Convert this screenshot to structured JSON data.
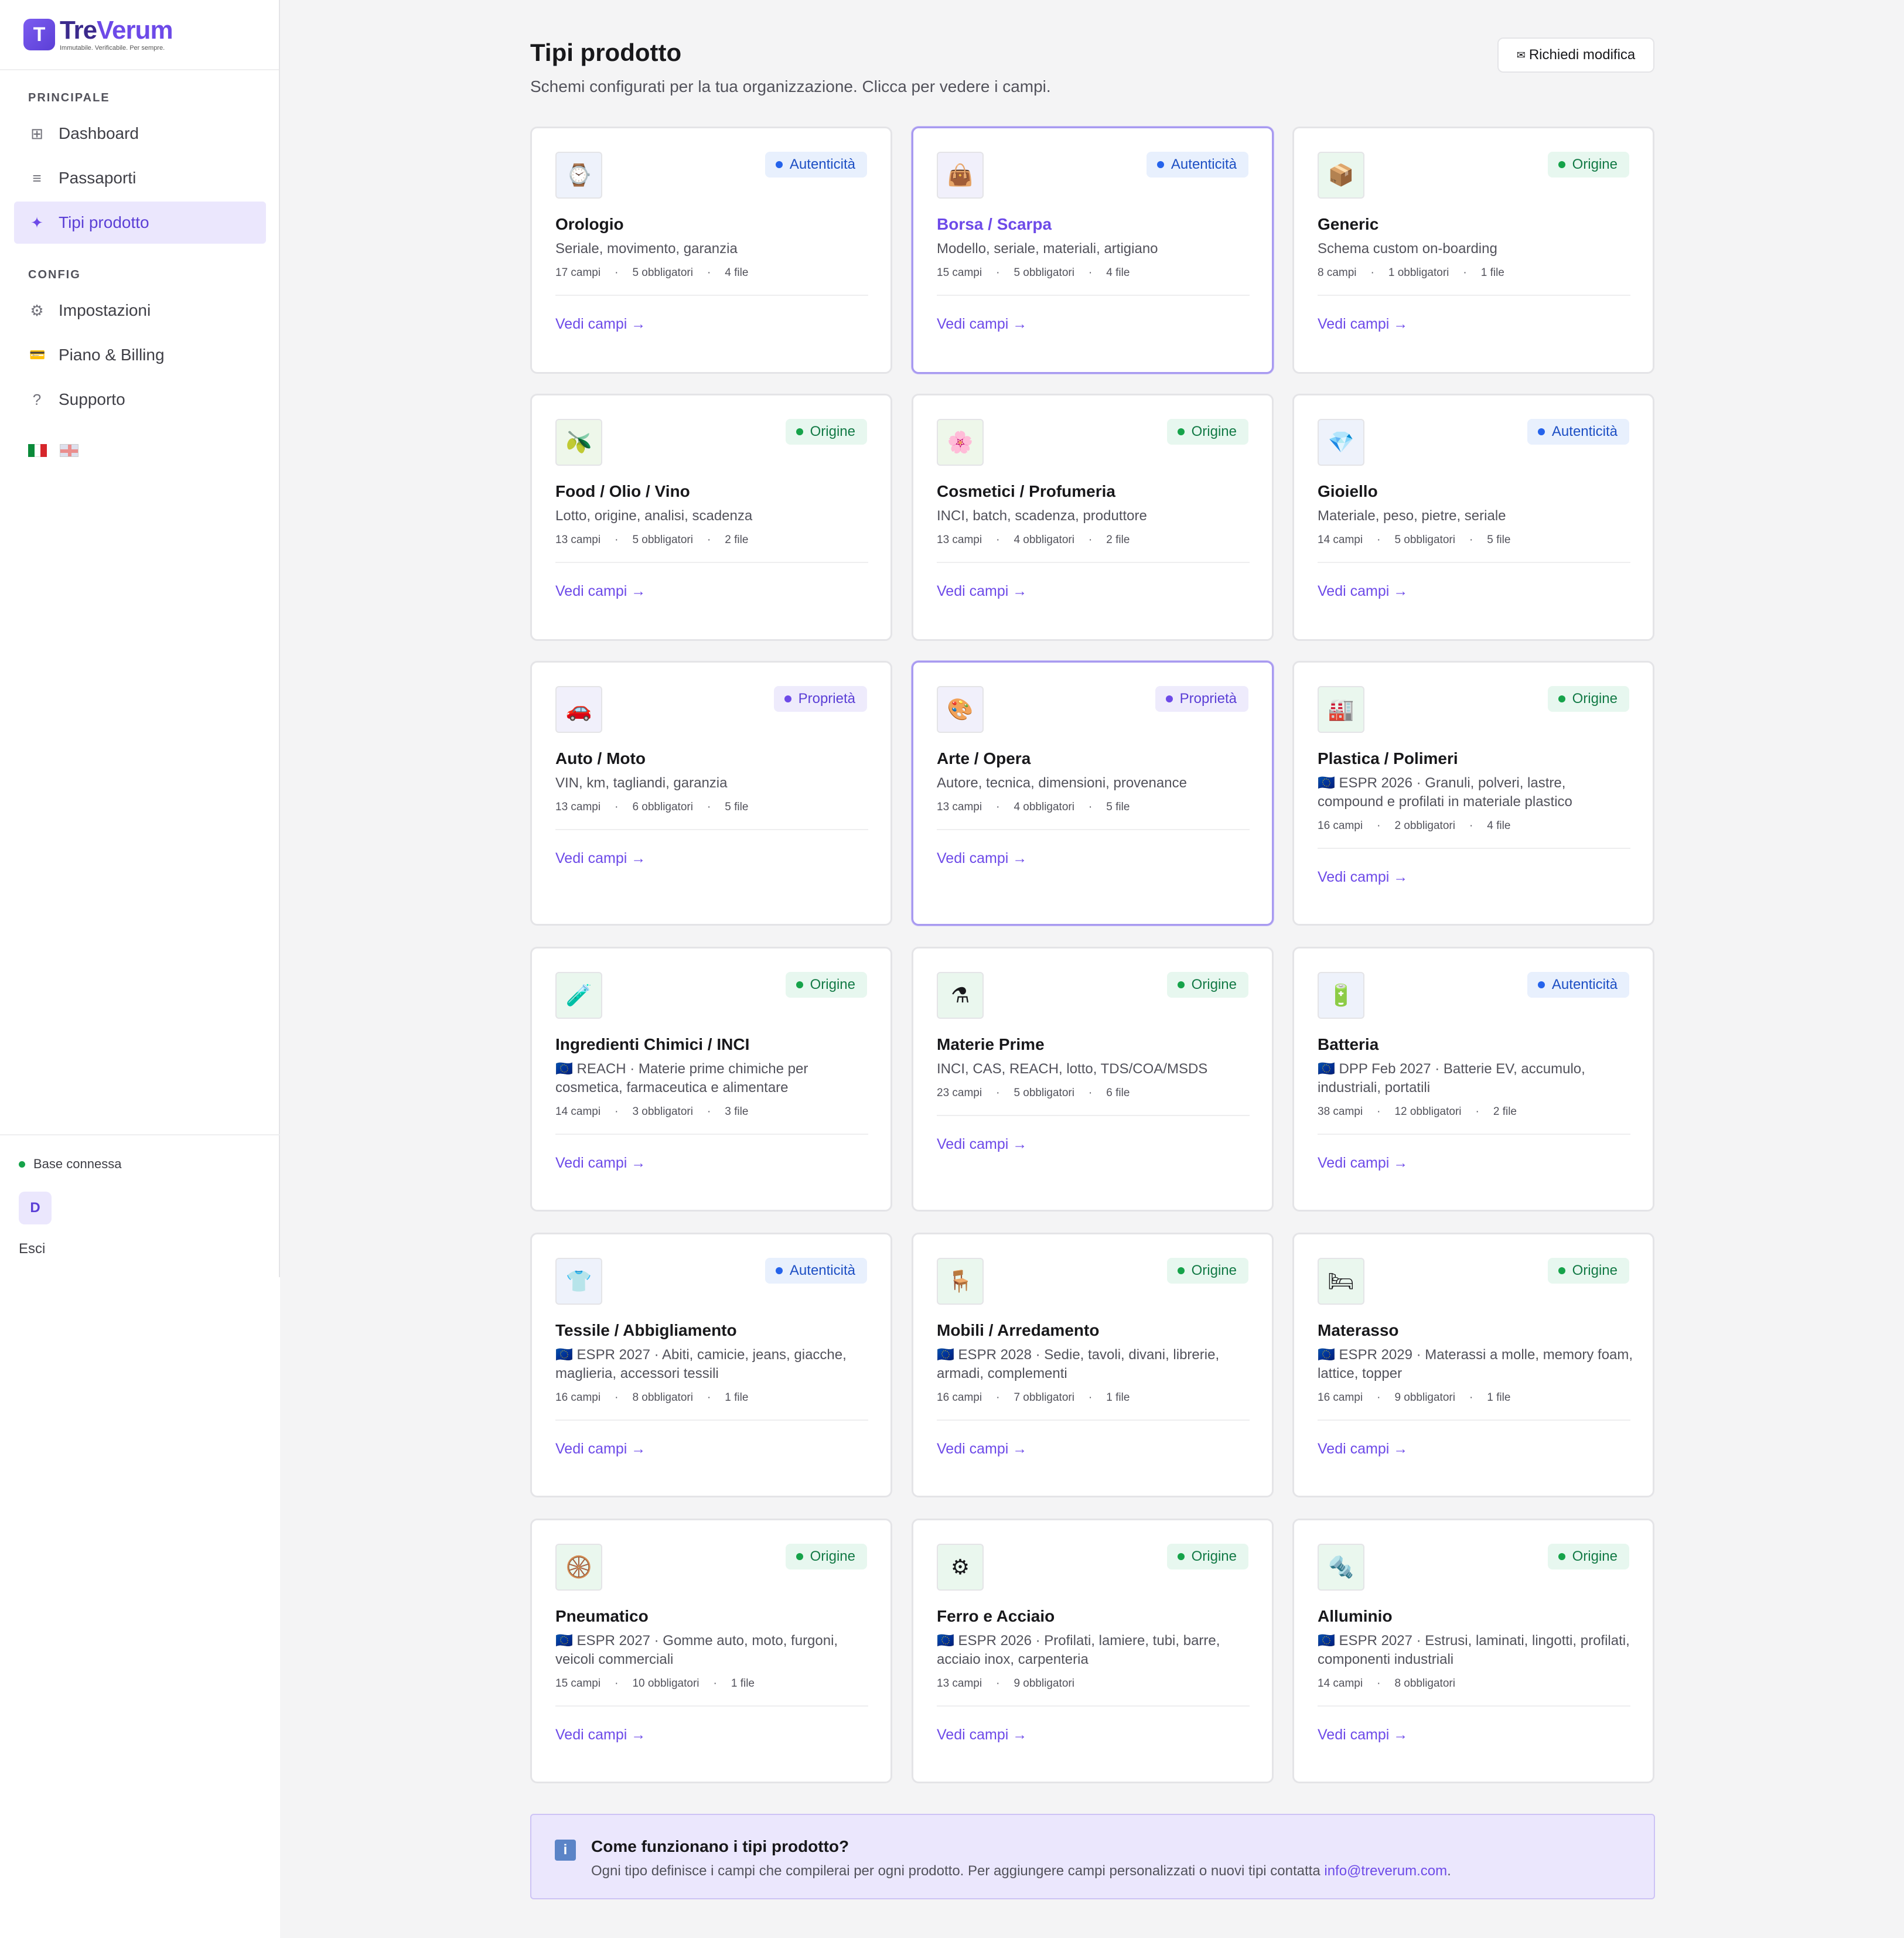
{
  "brand": {
    "name_a": "Tre",
    "name_b": "Verum",
    "tagline": "Immutabile. Verificabile. Per sempre.",
    "logo_letter": "T"
  },
  "sidebar": {
    "section_main": "PRINCIPALE",
    "section_config": "CONFIG",
    "items": [
      {
        "label": "Dashboard",
        "icon": "grid-icon",
        "glyph": "⊞"
      },
      {
        "label": "Passaporti",
        "icon": "list-icon",
        "glyph": "≡"
      },
      {
        "label": "Tipi prodotto",
        "icon": "sparkle-icon",
        "glyph": "✦"
      },
      {
        "label": "Impostazioni",
        "icon": "gear-icon",
        "glyph": "⚙"
      },
      {
        "label": "Piano & Billing",
        "icon": "credit-card-icon",
        "glyph": "💳"
      },
      {
        "label": "Supporto",
        "icon": "question-icon",
        "glyph": "?"
      }
    ],
    "status": "Base connessa",
    "avatar": "D",
    "logout": "Esci"
  },
  "header": {
    "title": "Tipi prodotto",
    "subtitle": "Schemi configurati per la tua organizzazione. Clicca per vedere i campi.",
    "request_button": "Richiedi modifica",
    "request_icon": "✉"
  },
  "cards": [
    {
      "title": "Orologio",
      "icon": "⌚",
      "badge": "Autenticità",
      "desc": "Seriale, movimento, garanzia",
      "fields": "17 campi",
      "required": "5 obbligatori",
      "files": "4 file",
      "link": "Vedi campi →"
    },
    {
      "title": "Borsa / Scarpa",
      "icon": "👜",
      "badge": "Autenticità",
      "desc": "Modello, seriale, materiali, artigiano",
      "fields": "15 campi",
      "required": "5 obbligatori",
      "files": "4 file",
      "link": "Vedi campi →"
    },
    {
      "title": "Generic",
      "icon": "📦",
      "badge": "Origine",
      "desc": "Schema custom on-boarding",
      "fields": "8 campi",
      "required": "1 obbligatori",
      "files": "1 file",
      "link": "Vedi campi →"
    },
    {
      "title": "Food / Olio / Vino",
      "icon": "🫒",
      "badge": "Origine",
      "desc": "Lotto, origine, analisi, scadenza",
      "fields": "13 campi",
      "required": "5 obbligatori",
      "files": "2 file",
      "link": "Vedi campi →"
    },
    {
      "title": "Cosmetici / Profumeria",
      "icon": "🌸",
      "badge": "Origine",
      "desc": "INCI, batch, scadenza, produttore",
      "fields": "13 campi",
      "required": "4 obbligatori",
      "files": "2 file",
      "link": "Vedi campi →"
    },
    {
      "title": "Gioiello",
      "icon": "💎",
      "badge": "Autenticità",
      "desc": "Materiale, peso, pietre, seriale",
      "fields": "14 campi",
      "required": "5 obbligatori",
      "files": "5 file",
      "link": "Vedi campi →"
    },
    {
      "title": "Auto / Moto",
      "icon": "🚗",
      "badge": "Proprietà",
      "desc": "VIN, km, tagliandi, garanzia",
      "fields": "13 campi",
      "required": "6 obbligatori",
      "files": "5 file",
      "link": "Vedi campi →"
    },
    {
      "title": "Arte / Opera",
      "icon": "🎨",
      "badge": "Proprietà",
      "desc": "Autore, tecnica, dimensioni, provenance",
      "fields": "13 campi",
      "required": "4 obbligatori",
      "files": "5 file",
      "link": "Vedi campi →"
    },
    {
      "title": "Plastica / Polimeri",
      "icon": "🏭",
      "badge": "Origine",
      "desc": "🇪🇺 ESPR 2026 · Granuli, polveri, lastre, compound e profilati in materiale plastico",
      "fields": "16 campi",
      "required": "2 obbligatori",
      "files": "4 file",
      "link": "Vedi campi →"
    },
    {
      "title": "Ingredienti Chimici / INCI",
      "icon": "🧪",
      "badge": "Origine",
      "desc": "🇪🇺 REACH · Materie prime chimiche per cosmetica, farmaceutica e alimentare",
      "fields": "14 campi",
      "required": "3 obbligatori",
      "files": "3 file",
      "link": "Vedi campi →"
    },
    {
      "title": "Materie Prime",
      "icon": "⚗",
      "badge": "Origine",
      "desc": "INCI, CAS, REACH, lotto, TDS/COA/MSDS",
      "fields": "23 campi",
      "required": "5 obbligatori",
      "files": "6 file",
      "link": "Vedi campi →"
    },
    {
      "title": "Batteria",
      "icon": "🔋",
      "badge": "Autenticità",
      "desc": "🇪🇺 DPP Feb 2027 · Batterie EV, accumulo, industriali, portatili",
      "fields": "38 campi",
      "required": "12 obbligatori",
      "files": "2 file",
      "link": "Vedi campi →"
    },
    {
      "title": "Tessile / Abbigliamento",
      "icon": "👕",
      "badge": "Autenticità",
      "desc": "🇪🇺 ESPR 2027 · Abiti, camicie, jeans, giacche, maglieria, accessori tessili",
      "fields": "16 campi",
      "required": "8 obbligatori",
      "files": "1 file",
      "link": "Vedi campi →"
    },
    {
      "title": "Mobili / Arredamento",
      "icon": "🪑",
      "badge": "Origine",
      "desc": "🇪🇺 ESPR 2028 · Sedie, tavoli, divani, librerie, armadi, complementi",
      "fields": "16 campi",
      "required": "7 obbligatori",
      "files": "1 file",
      "link": "Vedi campi →"
    },
    {
      "title": "Materasso",
      "icon": "🛏",
      "badge": "Origine",
      "desc": "🇪🇺 ESPR 2029 · Materassi a molle, memory foam, lattice, topper",
      "fields": "16 campi",
      "required": "9 obbligatori",
      "files": "1 file",
      "link": "Vedi campi →"
    },
    {
      "title": "Pneumatico",
      "icon": "🛞",
      "badge": "Origine",
      "desc": "🇪🇺 ESPR 2027 · Gomme auto, moto, furgoni, veicoli commerciali",
      "fields": "15 campi",
      "required": "10 obbligatori",
      "files": "1 file",
      "link": "Vedi campi →"
    },
    {
      "title": "Ferro e Acciaio",
      "icon": "⚙",
      "badge": "Origine",
      "desc": "🇪🇺 ESPR 2026 · Profilati, lamiere, tubi, barre, acciaio inox, carpenteria",
      "fields": "13 campi",
      "required": "9 obbligatori",
      "files": "",
      "link": "Vedi campi →"
    },
    {
      "title": "Alluminio",
      "icon": "🔩",
      "badge": "Origine",
      "desc": "🇪🇺 ESPR 2027 · Estrusi, laminati, lingotti, profilati, componenti industriali",
      "fields": "14 campi",
      "required": "8 obbligatori",
      "files": "",
      "link": "Vedi campi →"
    }
  ],
  "info": {
    "title": "Come funzionano i tipi prodotto?",
    "text": "Ogni tipo definisce i campi che compilerai per ogni prodotto. Per aggiungere campi personalizzati o nuovi tipi contatta ",
    "email": "info@treverum.com",
    "end": ".",
    "icon": "i"
  },
  "colors": {
    "accent": "#6d4ae8",
    "origine": "#16a34a",
    "autenticita": "#2563eb",
    "proprieta": "#6d4ae8"
  }
}
